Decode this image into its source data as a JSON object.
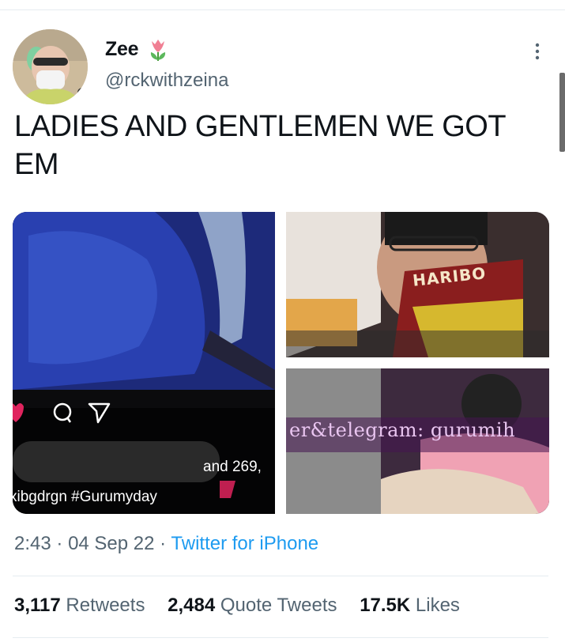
{
  "author": {
    "display_name": "Zee",
    "name_emoji": "tulip-icon",
    "handle": "@rckwithzeina"
  },
  "tweet": {
    "text": "LADIES AND GENTLEMEN WE GOT EM"
  },
  "media": {
    "image1": {
      "caption_name": "xibgdrgn #Gurumyday",
      "caption_and": "and 269,"
    },
    "image2": {
      "snack_text": "HARIBO"
    },
    "image3": {
      "overlay_text": "er&telegram: gurumih"
    }
  },
  "meta": {
    "time": "2:43",
    "separator": "·",
    "date": "04 Sep 22",
    "source": "Twitter for iPhone"
  },
  "stats": {
    "retweets_count": "3,117",
    "retweets_label": "Retweets",
    "quotes_count": "2,484",
    "quotes_label": "Quote Tweets",
    "likes_count": "17.5K",
    "likes_label": "Likes"
  },
  "colors": {
    "link": "#1d9bf0",
    "secondary_text": "#536471",
    "primary_text": "#0f1419"
  }
}
